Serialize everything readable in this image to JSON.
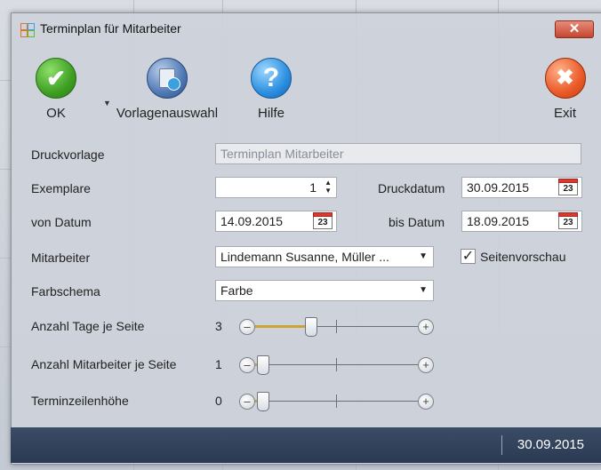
{
  "window": {
    "title": "Terminplan für Mitarbeiter",
    "close_glyph": "✕"
  },
  "toolbar": {
    "ok_label": "OK",
    "vorlagen_label": "Vorlagenauswahl",
    "hilfe_label": "Hilfe",
    "exit_label": "Exit",
    "ok_glyph": "✔",
    "help_glyph": "?",
    "exit_glyph": "✖",
    "dropdown_glyph": "▼"
  },
  "form": {
    "druckvorlage_label": "Druckvorlage",
    "druckvorlage_value": "Terminplan Mitarbeiter",
    "exemplare_label": "Exemplare",
    "exemplare_value": "1",
    "druckdatum_label": "Druckdatum",
    "druckdatum_value": "30.09.2015",
    "von_datum_label": "von Datum",
    "von_datum_value": "14.09.2015",
    "bis_datum_label": "bis Datum",
    "bis_datum_value": "18.09.2015",
    "calendar_day": "23",
    "mitarbeiter_label": "Mitarbeiter",
    "mitarbeiter_value": "Lindemann Susanne, Müller ...",
    "seitenvorschau_label": "Seitenvorschau",
    "seitenvorschau_checked": true,
    "seitenvorschau_check_glyph": "✓",
    "farbschema_label": "Farbschema",
    "farbschema_value": "Farbe",
    "dropdown_arrow": "▼",
    "spin_up": "▲",
    "spin_down": "▼"
  },
  "sliders": {
    "tage": {
      "label": "Anzahl Tage je Seite",
      "value": "3",
      "level": 0.33
    },
    "mitarbeiter": {
      "label": "Anzahl Mitarbeiter je Seite",
      "value": "1",
      "level": 0.0
    },
    "zeilenhoehe": {
      "label": "Terminzeilenhöhe",
      "value": "0",
      "level": 0.0
    },
    "minus_glyph": "–",
    "plus_glyph": "+"
  },
  "statusbar": {
    "date": "30.09.2015"
  },
  "icons": {
    "app": "app-grid-icon",
    "ok": "checkmark-icon",
    "vorlagen": "template-select-icon",
    "help": "question-mark-icon",
    "exit": "x-circle-icon",
    "calendar": "calendar-icon"
  },
  "colors": {
    "ok_green": "#3e9f23",
    "help_blue": "#2b8fe0",
    "exit_orange": "#ea5a28",
    "status_bar": "#2b3a52",
    "slider_fill": "#c9a535"
  }
}
